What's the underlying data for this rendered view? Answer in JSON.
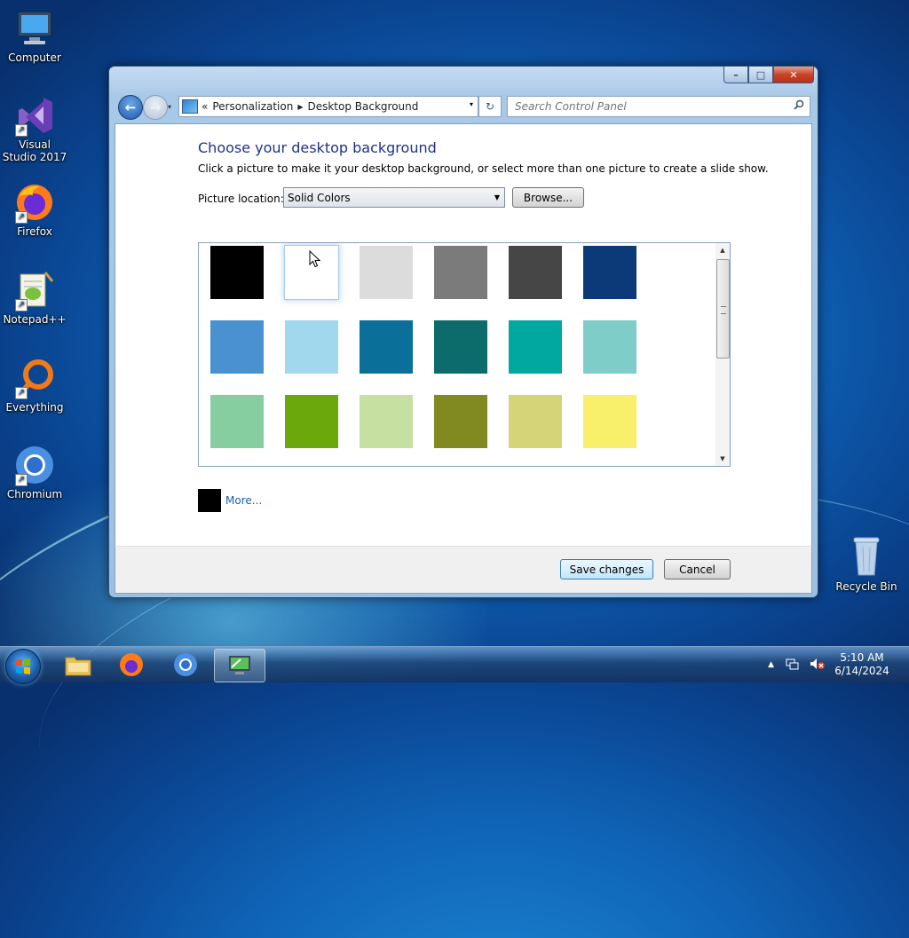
{
  "desktop": {
    "icons": [
      {
        "label": "Computer"
      },
      {
        "label": "Visual Studio 2017"
      },
      {
        "label": "Firefox"
      },
      {
        "label": "Notepad++"
      },
      {
        "label": "Everything"
      },
      {
        "label": "Chromium"
      }
    ],
    "recycle_bin": {
      "label": "Recycle Bin"
    }
  },
  "window": {
    "caption_buttons": {
      "minimize": "–",
      "maximize": "□",
      "close": "✕"
    },
    "nav": {
      "back": "←",
      "forward": "→",
      "recent": "▾"
    },
    "address": {
      "overflow": "«",
      "crumbs": [
        "Personalization",
        "Desktop Background"
      ],
      "separator": "▶",
      "dropdown": "▾"
    },
    "refresh": "↻",
    "search": {
      "placeholder": "Search Control Panel",
      "icon": "search-icon"
    },
    "heading": "Choose your desktop background",
    "description": "Click a picture to make it your desktop background, or select more than one picture to create a slide show.",
    "picture_location": {
      "label": "Picture location:",
      "value": "Solid Colors",
      "arrow": "▼"
    },
    "browse_label": "Browse...",
    "swatches": [
      {
        "color": "#000000"
      },
      {
        "color": "#ffffff",
        "selected": true
      },
      {
        "color": "#dcdcdc"
      },
      {
        "color": "#7b7b7b"
      },
      {
        "color": "#464646"
      },
      {
        "color": "#0c3a78"
      },
      {
        "color": "#4a92cf"
      },
      {
        "color": "#a2d8ee"
      },
      {
        "color": "#0a709a"
      },
      {
        "color": "#0c6b6b"
      },
      {
        "color": "#00a8a0"
      },
      {
        "color": "#7ecdc8"
      },
      {
        "color": "#86cda0"
      },
      {
        "color": "#6aa80c"
      },
      {
        "color": "#c5e0a0"
      },
      {
        "color": "#808a20"
      },
      {
        "color": "#d6d479"
      },
      {
        "color": "#f8f06a"
      }
    ],
    "scroll": {
      "up": "▲",
      "down": "▼"
    },
    "more_color": "#000000",
    "more_label": "More...",
    "save_label": "Save changes",
    "cancel_label": "Cancel"
  },
  "taskbar": {
    "items": [
      "start-button",
      "file-explorer",
      "firefox",
      "chromium",
      "control-panel"
    ],
    "clock": {
      "time": "5:10 AM",
      "date": "6/14/2024"
    },
    "tray": {
      "show_hidden": "▲"
    }
  },
  "colors": {
    "accent": "#1e3287",
    "link": "#1a5fb4"
  }
}
